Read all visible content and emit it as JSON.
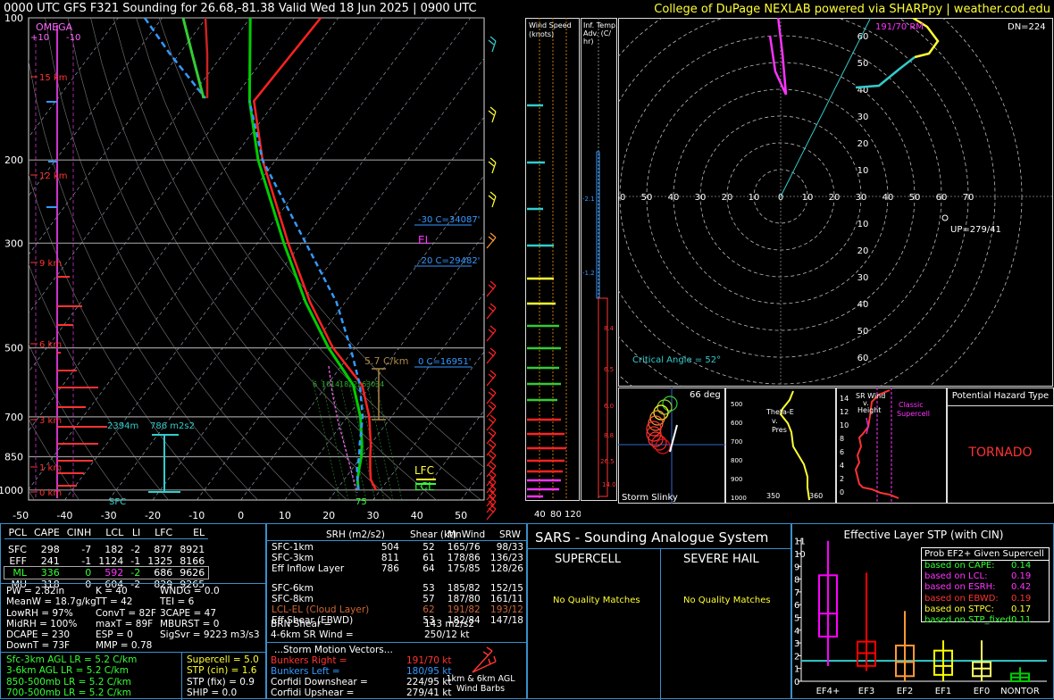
{
  "header": {
    "title": "0000 UTC GFS F321 Sounding for 26.68,-81.38 Valid  Wed 18 Jun 2025 | 0900 UTC",
    "credit": "College of DuPage NEXLAB powered via SHARPpy | weather.cod.edu"
  },
  "skewt": {
    "pressure_ticks": [
      "100",
      "200",
      "300",
      "500",
      "700",
      "850",
      "1000"
    ],
    "temp_ticks": [
      "-50",
      "-40",
      "-30",
      "-20",
      "-10",
      "0",
      "10",
      "20",
      "30",
      "40",
      "50"
    ],
    "omega_label": "OMEGA",
    "omega_scale": [
      "+10",
      "-10"
    ],
    "height_labels": [
      "15 km",
      "12 km",
      "9 km",
      "6 km",
      "3 km",
      "1 km",
      "0 km"
    ],
    "freezing_labels": [
      "-30 C=34087'",
      "-20 C=29482'",
      "0 C=16951'"
    ],
    "el_label": "EL",
    "lfc_label": "LFC",
    "lcl_label": "LCL",
    "lapse_label": "5.7 C/km",
    "srh_label": "786 m2s2",
    "eil_height_label": "2394m",
    "sfc_label": "SFC",
    "sfc_temp": "75",
    "theta_e_labels": [
      "6",
      "10",
      "14",
      "18",
      "22",
      "26",
      "30",
      "34"
    ]
  },
  "chart_data": {
    "type": "line",
    "title": "0000 UTC GFS F321 Sounding for 26.68,-81.38 Valid  Wed 18 Jun 2025 | 0900 UTC",
    "xlabel": "",
    "ylabel": "",
    "ylim": [
      1000,
      100
    ],
    "xlim": [
      -50,
      50
    ],
    "series": [
      {
        "values": [
          [
            1000,
            29
          ],
          [
            950,
            26
          ],
          [
            900,
            24
          ],
          [
            850,
            22
          ],
          [
            800,
            20
          ],
          [
            700,
            15
          ],
          [
            600,
            8
          ],
          [
            500,
            -5
          ],
          [
            400,
            -18
          ],
          [
            300,
            -33
          ],
          [
            200,
            -53
          ],
          [
            150,
            -65
          ],
          [
            100,
            -64
          ]
        ]
      },
      {
        "values": [
          [
            1000,
            25
          ],
          [
            950,
            23
          ],
          [
            900,
            21.5
          ],
          [
            850,
            20
          ],
          [
            800,
            18
          ],
          [
            700,
            13
          ],
          [
            600,
            6
          ],
          [
            500,
            -6
          ],
          [
            400,
            -19
          ],
          [
            300,
            -34
          ],
          [
            200,
            -54
          ],
          [
            150,
            -66
          ],
          [
            100,
            -80
          ]
        ]
      },
      {
        "values": [
          [
            1000,
            25
          ],
          [
            950,
            23
          ],
          [
            900,
            21
          ],
          [
            850,
            19.5
          ],
          [
            800,
            17.5
          ],
          [
            700,
            13.5
          ],
          [
            600,
            7.5
          ],
          [
            500,
            -1
          ],
          [
            400,
            -12
          ],
          [
            300,
            -29
          ],
          [
            200,
            -53
          ],
          [
            150,
            -66
          ]
        ]
      }
    ]
  },
  "windspeed": {
    "label": "Wind Speed (knots)",
    "ticks": [
      "40",
      "80",
      "120"
    ]
  },
  "tadv": {
    "label": "Inf. Temp. Adv. (C/ hr)",
    "values": [
      "-2.1",
      "-1.2",
      "8.4",
      "6.5",
      "6.0",
      "8.8",
      "26.5",
      "14.0"
    ]
  },
  "hodograph": {
    "rm_label": "191/70 RM",
    "dn_label": "DN=224",
    "up_label": "UP=279/41",
    "critical_angle": "Critical Angle = 52°",
    "ring_labels": [
      "70",
      "60",
      "50",
      "40",
      "30",
      "20",
      "10",
      "0",
      "10",
      "20",
      "30",
      "40",
      "50",
      "60",
      "70"
    ]
  },
  "slinky": {
    "deg": "66 deg",
    "label": "Storm Slinky"
  },
  "thetae": {
    "label": "Theta-E v. Pres",
    "ticks": [
      "500",
      "600",
      "700",
      "800",
      "900",
      "1000"
    ],
    "xticks": [
      "350",
      "360"
    ]
  },
  "srwind": {
    "label": "SR Wind v. Height",
    "ticks": [
      "14",
      "12",
      "10",
      "8",
      "6",
      "4",
      "2",
      "0"
    ],
    "classic": "Classic Supercell"
  },
  "hazard": {
    "title": "Potential Hazard Type",
    "value": "TORNADO"
  },
  "parcels": {
    "headers": [
      "PCL",
      "CAPE",
      "CINH",
      "LCL",
      "LI",
      "LFC",
      "EL"
    ],
    "rows": [
      [
        "SFC",
        "298",
        "-7",
        "182",
        "-2",
        "877",
        "8921"
      ],
      [
        "EFF",
        "241",
        "-1",
        "1124",
        "-1",
        "1325",
        "8166"
      ],
      [
        "ML",
        "336",
        "0",
        "592",
        "-2",
        "686",
        "9626"
      ],
      [
        "MU",
        "318",
        "0",
        "604",
        "-2",
        "829",
        "9265"
      ]
    ]
  },
  "indices": {
    "col1": [
      "PW = 2.82in",
      "MeanW = 18.7g/kg",
      "LowRH = 97%",
      "MidRH = 100%",
      "DCAPE = 230",
      "DownT = 73F"
    ],
    "col2": [
      "K = 40",
      "TT = 42",
      "ConvT = 82F",
      "maxT = 89F",
      "ESP = 0",
      "MMP = 0.78"
    ],
    "col3": [
      "WNDG = 0.0",
      "TEI = 6",
      "3CAPE = 47",
      "MBURST = 0",
      "",
      "SigSvr = 9223 m3/s3"
    ],
    "lapse": [
      "Sfc-3km AGL LR = 5.2 C/km",
      "3-6km AGL LR = 5.2 C/km",
      "850-500mb LR = 5.2 C/km",
      "700-500mb LR = 5.2 C/km"
    ],
    "composite": [
      "Supercell = 5.0",
      "STP (cin) = 1.6",
      "STP (fix) = 0.9",
      "SHIP = 0.0"
    ]
  },
  "kinematics": {
    "headers": [
      "SRH (m2/s2)",
      "Shear (kt)",
      "MnWind",
      "SRW"
    ],
    "rows": [
      [
        "SFC-1km",
        "504",
        "52",
        "165/76",
        "98/33"
      ],
      [
        "SFC-3km",
        "811",
        "61",
        "178/86",
        "136/23"
      ],
      [
        "Eff Inflow Layer",
        "786",
        "64",
        "175/85",
        "128/26"
      ],
      [
        "",
        "",
        "",
        "",
        ""
      ],
      [
        "SFC-6km",
        "53",
        "185/82",
        "152/15",
        ""
      ],
      [
        "SFC-8km",
        "57",
        "187/80",
        "161/11",
        ""
      ],
      [
        "LCL-EL (Cloud Layer)",
        "62",
        "191/82",
        "193/12",
        ""
      ],
      [
        "Eff Shear (EBWD)",
        "53",
        "182/84",
        "147/18",
        ""
      ]
    ],
    "brn": [
      "BRN Shear =",
      "143 m2/s2"
    ],
    "srw46": [
      "4-6km SR Wind =",
      "250/12 kt"
    ],
    "motion_title": "...Storm Motion Vectors...",
    "motion": [
      [
        "Bunkers Right =",
        "191/70 kt"
      ],
      [
        "Bunkers Left =",
        "180/95 kt"
      ],
      [
        "Corfidi Downshear =",
        "224/95 kt"
      ],
      [
        "Corfidi Upshear =",
        "279/41 kt"
      ]
    ],
    "barbs_label": "1km & 6km AGL Wind Barbs"
  },
  "sars": {
    "title": "SARS - Sounding Analogue System",
    "supercell": "SUPERCELL",
    "hail": "SEVERE HAIL",
    "supercell_result": "No Quality Matches",
    "hail_result": "No Quality Matches"
  },
  "stp": {
    "title": "Effective Layer STP (with CIN)",
    "categories": [
      "EF4+",
      "EF3",
      "EF2",
      "EF1",
      "EF0",
      "NONTOR"
    ],
    "yticks": [
      "11",
      "10",
      "9",
      "8",
      "7",
      "6",
      "5",
      "4",
      "3",
      "2",
      "1",
      "0"
    ],
    "prob_title": "Prob EF2+ Given Supercell",
    "probs": [
      [
        "based on CAPE:",
        "0.14"
      ],
      [
        "based on LCL:",
        "0.19"
      ],
      [
        "based on ESRH:",
        "0.42"
      ],
      [
        "based on EBWD:",
        "0.19"
      ],
      [
        "based on STPC:",
        "0.17"
      ],
      [
        "based on STP_fixed:",
        "0.11"
      ]
    ],
    "value": 1.6,
    "colors": {
      "EF4+": "#ff00ff",
      "EF3": "#ff0000",
      "EF2": "#ff9933",
      "EF1": "#ffff00",
      "EF0": "#ffff66",
      "NONTOR": "#00cc00"
    }
  }
}
